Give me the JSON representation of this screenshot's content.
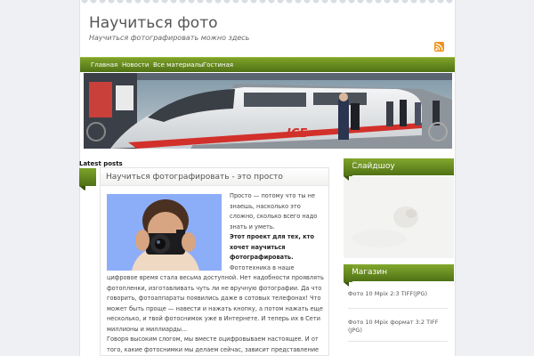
{
  "site": {
    "title": "Научиться фото",
    "description": "Научиться фотографировать можно здесь"
  },
  "icons": {
    "rss": "rss-feed-icon"
  },
  "nav": {
    "items": [
      {
        "label": "Главная"
      },
      {
        "label": "Новости"
      },
      {
        "label": "Все материалы"
      },
      {
        "label": "Гостиная"
      }
    ]
  },
  "colors": {
    "accent_green": "#5f8a1c",
    "rss_orange": "#f0921e"
  },
  "content": {
    "section_label": "Latest posts",
    "post": {
      "title": "Научиться фотографировать - это просто",
      "p1": "Просто — потому что ты не знаешь, насколько это сложно, сколько всего надо знать и уметь.",
      "p2_bold": "Этот проект для тех, кто хочет научиться фотографировать.",
      "p3": "Фототехника в наше цифровое время стала весьма доступной. Нет надобности проявлять фотопленки, изготавливать чуть ли не вручную фотографии. Да что говорить,   фотоаппараты появились даже в сотовых телефонах! Что может быть проще — навести и нажать кнопку, а потом нажать еще несколько, и твой фотоснимок уже в  Интернете. И теперь их в Сети миллионы и миллиарды...",
      "p4": "Говоря высоким слогом, мы вместе оцифровываем настоящее. И от того, какие фотоснимки мы делаем сейчас, зависит представление"
    }
  },
  "sidebar": {
    "slideshow_title": "Слайдшоу",
    "shop_title": "Магазин",
    "shop_items": [
      {
        "label": "Фото 10 Mpix 2:3 TIFF(JPG)"
      },
      {
        "label": "Фото 10 Mpix формат 3:2 TIFF (JPG)"
      }
    ]
  }
}
